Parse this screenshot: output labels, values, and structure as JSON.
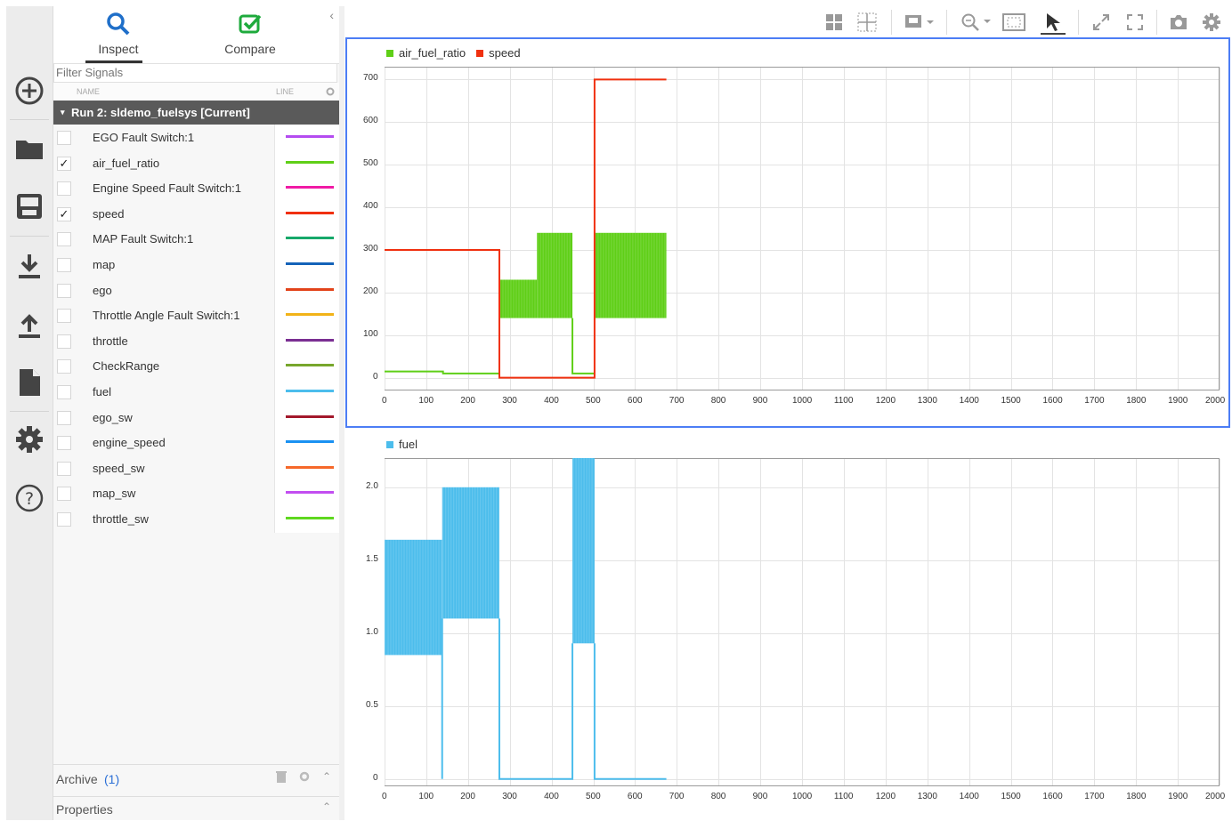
{
  "nav_rail": {
    "items": [
      "add-icon",
      "folder-icon",
      "save-icon",
      "download-icon",
      "upload-icon",
      "document-icon",
      "gear-icon",
      "help-icon"
    ]
  },
  "tabs": [
    {
      "label": "Inspect",
      "active": true
    },
    {
      "label": "Compare",
      "active": false
    }
  ],
  "collapse_glyph": "‹",
  "filter": {
    "placeholder": "Filter Signals"
  },
  "columns": {
    "name": "NAME",
    "line": "LINE"
  },
  "run": {
    "label": "Run 2: sldemo_fuelsys [Current]"
  },
  "signals": [
    {
      "name": "EGO Fault Switch:1",
      "checked": false,
      "color": "#b44cf0"
    },
    {
      "name": "air_fuel_ratio",
      "checked": true,
      "color": "#5fcf17"
    },
    {
      "name": "Engine Speed Fault Switch:1",
      "checked": false,
      "color": "#f01aa5"
    },
    {
      "name": "speed",
      "checked": true,
      "color": "#f0300f"
    },
    {
      "name": "MAP Fault Switch:1",
      "checked": false,
      "color": "#16a86a"
    },
    {
      "name": "map",
      "checked": false,
      "color": "#1463b9"
    },
    {
      "name": "ego",
      "checked": false,
      "color": "#e2431a"
    },
    {
      "name": "Throttle Angle Fault Switch:1",
      "checked": false,
      "color": "#f2b318"
    },
    {
      "name": "throttle",
      "checked": false,
      "color": "#7a2f92"
    },
    {
      "name": "CheckRange",
      "checked": false,
      "color": "#78a62c"
    },
    {
      "name": "fuel",
      "checked": false,
      "color": "#4cbdec"
    },
    {
      "name": "ego_sw",
      "checked": false,
      "color": "#a3182b"
    },
    {
      "name": "engine_speed",
      "checked": false,
      "color": "#1a91f2"
    },
    {
      "name": "speed_sw",
      "checked": false,
      "color": "#f6682a"
    },
    {
      "name": "map_sw",
      "checked": false,
      "color": "#c24ef0"
    },
    {
      "name": "throttle_sw",
      "checked": false,
      "color": "#5fd81f"
    }
  ],
  "archive": {
    "label": "Archive",
    "count": "(1)"
  },
  "properties": {
    "label": "Properties"
  },
  "toolbar_icons": [
    "layout-grid-icon",
    "subplot-icon",
    "visualization-icon",
    "zoom-icon",
    "fit-to-view-icon",
    "cursor-icon",
    "expand-icon",
    "fullscreen-icon",
    "snapshot-icon",
    "settings-icon"
  ],
  "chart_data": [
    {
      "type": "line",
      "title": "",
      "xlim": [
        0,
        2000
      ],
      "ylim": [
        -30,
        730
      ],
      "x_ticks": [
        0,
        100,
        200,
        300,
        400,
        500,
        600,
        700,
        800,
        900,
        1000,
        1100,
        1200,
        1300,
        1400,
        1500,
        1600,
        1700,
        1800,
        1900,
        2000
      ],
      "y_ticks": [
        0,
        100,
        200,
        300,
        400,
        500,
        600,
        700
      ],
      "grid": true,
      "legend_position": "top-left",
      "series": [
        {
          "name": "air_fuel_ratio",
          "color": "#5fcf17",
          "segments": [
            {
              "kind": "line",
              "x": [
                0,
                140,
                140,
                275
              ],
              "y": [
                14.7,
                14.7,
                10,
                10
              ]
            },
            {
              "kind": "band",
              "x": [
                275,
                365
              ],
              "y": [
                140,
                230
              ]
            },
            {
              "kind": "band",
              "x": [
                365,
                450
              ],
              "y": [
                140,
                340
              ]
            },
            {
              "kind": "line",
              "x": [
                450,
                450,
                503
              ],
              "y": [
                140,
                10,
                10
              ]
            },
            {
              "kind": "band",
              "x": [
                503,
                675
              ],
              "y": [
                140,
                340
              ]
            }
          ]
        },
        {
          "name": "speed",
          "color": "#f0300f",
          "segments": [
            {
              "kind": "line",
              "x": [
                0,
                275,
                275,
                503,
                503,
                675
              ],
              "y": [
                300,
                300,
                0,
                0,
                700,
                700
              ]
            }
          ]
        }
      ]
    },
    {
      "type": "line",
      "title": "",
      "xlim": [
        0,
        2000
      ],
      "ylim": [
        -0.05,
        2.2
      ],
      "x_ticks": [
        0,
        100,
        200,
        300,
        400,
        500,
        600,
        700,
        800,
        900,
        1000,
        1100,
        1200,
        1300,
        1400,
        1500,
        1600,
        1700,
        1800,
        1900,
        2000
      ],
      "y_ticks": [
        0,
        0.5,
        1.0,
        1.5,
        2.0
      ],
      "y_tick_labels": [
        "0",
        "0.5",
        "1.0",
        "1.5",
        "2.0"
      ],
      "grid": true,
      "legend_position": "top-left",
      "series": [
        {
          "name": "fuel",
          "color": "#4cbdec",
          "segments": [
            {
              "kind": "band",
              "x": [
                0,
                138
              ],
              "y": [
                0.85,
                1.64
              ]
            },
            {
              "kind": "line",
              "x": [
                138,
                138,
                138
              ],
              "y": [
                0.85,
                0,
                1.1
              ]
            },
            {
              "kind": "band",
              "x": [
                138,
                275
              ],
              "y": [
                1.1,
                2.0
              ]
            },
            {
              "kind": "line",
              "x": [
                275,
                275,
                450,
                450
              ],
              "y": [
                1.1,
                0,
                0,
                0.93
              ]
            },
            {
              "kind": "band",
              "x": [
                450,
                503
              ],
              "y": [
                0.93,
                2.2
              ]
            },
            {
              "kind": "line",
              "x": [
                503,
                503,
                675
              ],
              "y": [
                0.93,
                0,
                0
              ]
            }
          ]
        }
      ]
    }
  ]
}
